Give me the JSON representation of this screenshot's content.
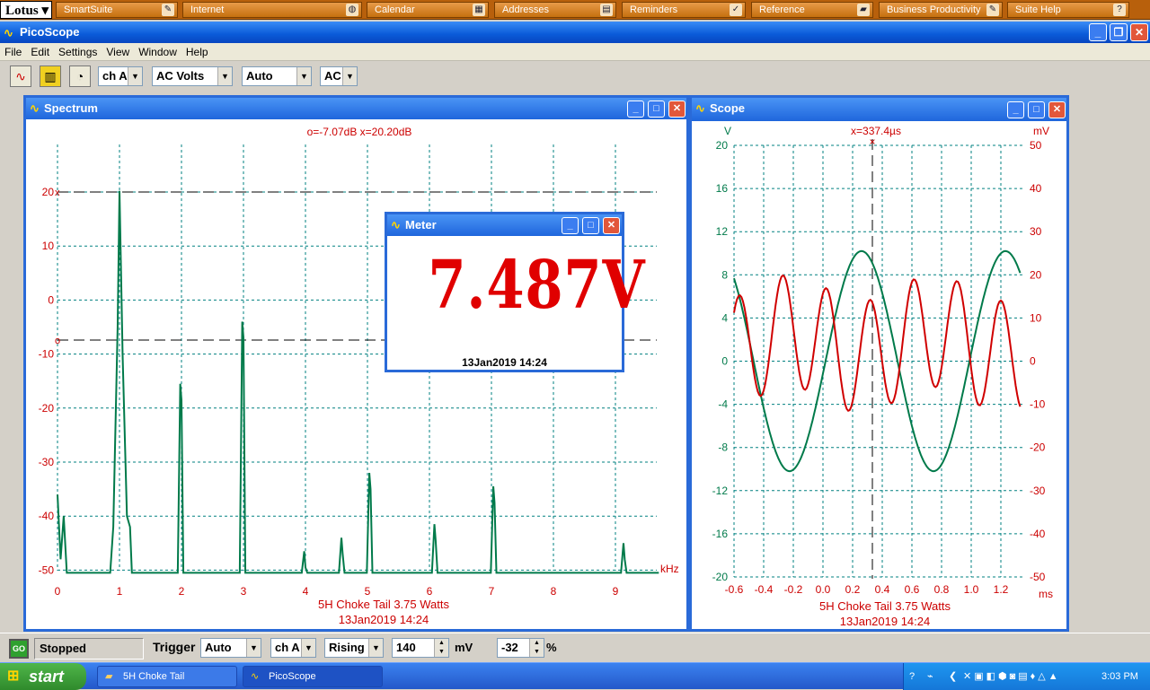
{
  "lotus": {
    "logo": "Lotus",
    "tabs": [
      {
        "label": "SmartSuite",
        "icon": "smartsuite-icon"
      },
      {
        "label": "Internet",
        "icon": "globe-icon"
      },
      {
        "label": "Calendar",
        "icon": "calendar-icon"
      },
      {
        "label": "Addresses",
        "icon": "addressbook-icon"
      },
      {
        "label": "Reminders",
        "icon": "checkmark-icon"
      },
      {
        "label": "Reference",
        "icon": "book-icon"
      },
      {
        "label": "Business Productivity",
        "icon": "tools-icon"
      },
      {
        "label": "Suite Help",
        "icon": "help-icon"
      }
    ]
  },
  "app": {
    "title": "PicoScope"
  },
  "menu": [
    "File",
    "Edit",
    "Settings",
    "View",
    "Window",
    "Help"
  ],
  "toolbar": {
    "channel": "ch A",
    "mode": "AC Volts",
    "range": "Auto",
    "coupling": "AC"
  },
  "spectrum": {
    "title": "Spectrum",
    "readout": "o=-7.07dB  x=20.20dB",
    "caption1": "5H Choke Tail 3.75 Watts",
    "caption2": "13Jan2019  14:24",
    "xunit": "kHz",
    "xticks": [
      "0",
      "1",
      "2",
      "3",
      "4",
      "5",
      "6",
      "7",
      "8",
      "9"
    ],
    "yticks": [
      "20",
      "10",
      "0",
      "-10",
      "-20",
      "-30",
      "-40",
      "-50"
    ],
    "cursor_x_label": "x",
    "cursor_o_label": "o"
  },
  "scope": {
    "title": "Scope",
    "readout": "x=337.4µs",
    "left_unit": "V",
    "right_unit": "mV",
    "xunit": "ms",
    "caption1": "5H Choke Tail 3.75 Watts",
    "caption2": "13Jan2019  14:24",
    "lticks": [
      "20",
      "16",
      "12",
      "8",
      "4",
      "0",
      "-4",
      "-8",
      "-12",
      "-16",
      "-20"
    ],
    "rticks": [
      "50",
      "40",
      "30",
      "20",
      "10",
      "0",
      "-10",
      "-20",
      "-30",
      "-40",
      "-50"
    ],
    "xticks": [
      "-0.6",
      "-0.4",
      "-0.2",
      "0.0",
      "0.2",
      "0.4",
      "0.6",
      "0.8",
      "1.0",
      "1.2"
    ]
  },
  "meter": {
    "title": "Meter",
    "value": "7.487V",
    "timestamp": "13Jan2019  14:24"
  },
  "status": {
    "go_label": "GO",
    "state": "Stopped",
    "trigger_label": "Trigger",
    "trigger_mode": "Auto",
    "trigger_channel": "ch A",
    "edge": "Rising",
    "level": "140",
    "level_unit": "mV",
    "delay": "-32",
    "delay_unit": "%"
  },
  "taskbar": {
    "start": "start",
    "tasks": [
      {
        "label": "5H Choke Tail",
        "icon": "folder-icon"
      },
      {
        "label": "PicoScope",
        "icon": "picoscope-icon"
      }
    ],
    "clock": "3:03 PM"
  },
  "colors": {
    "grid": "#008080",
    "trace_green": "#007a4a",
    "trace_red": "#d00000",
    "axis_red": "#cc0000",
    "title_blue": "#1f66dc"
  }
}
